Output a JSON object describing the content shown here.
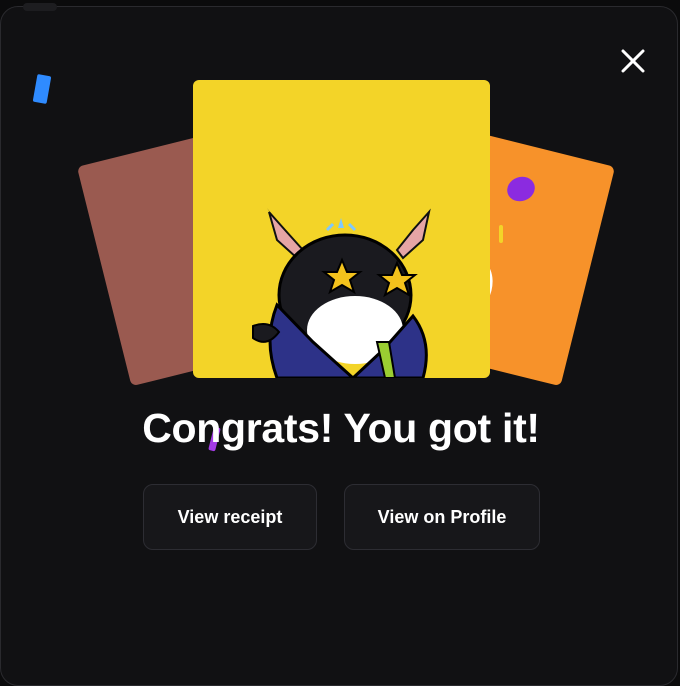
{
  "dialog": {
    "headline": "Congrats! You got it!",
    "close_icon": "close-icon"
  },
  "cards": [
    {
      "position": "left",
      "color": "#9a5a50"
    },
    {
      "position": "center",
      "color": "#f3d428"
    },
    {
      "position": "right",
      "color": "#f7922a"
    }
  ],
  "buttons": {
    "view_receipt": "View receipt",
    "view_on_profile": "View on Profile"
  },
  "colors": {
    "background": "#111113",
    "button_bg": "#17171a",
    "button_border": "#2d2d33",
    "text": "#ffffff"
  }
}
